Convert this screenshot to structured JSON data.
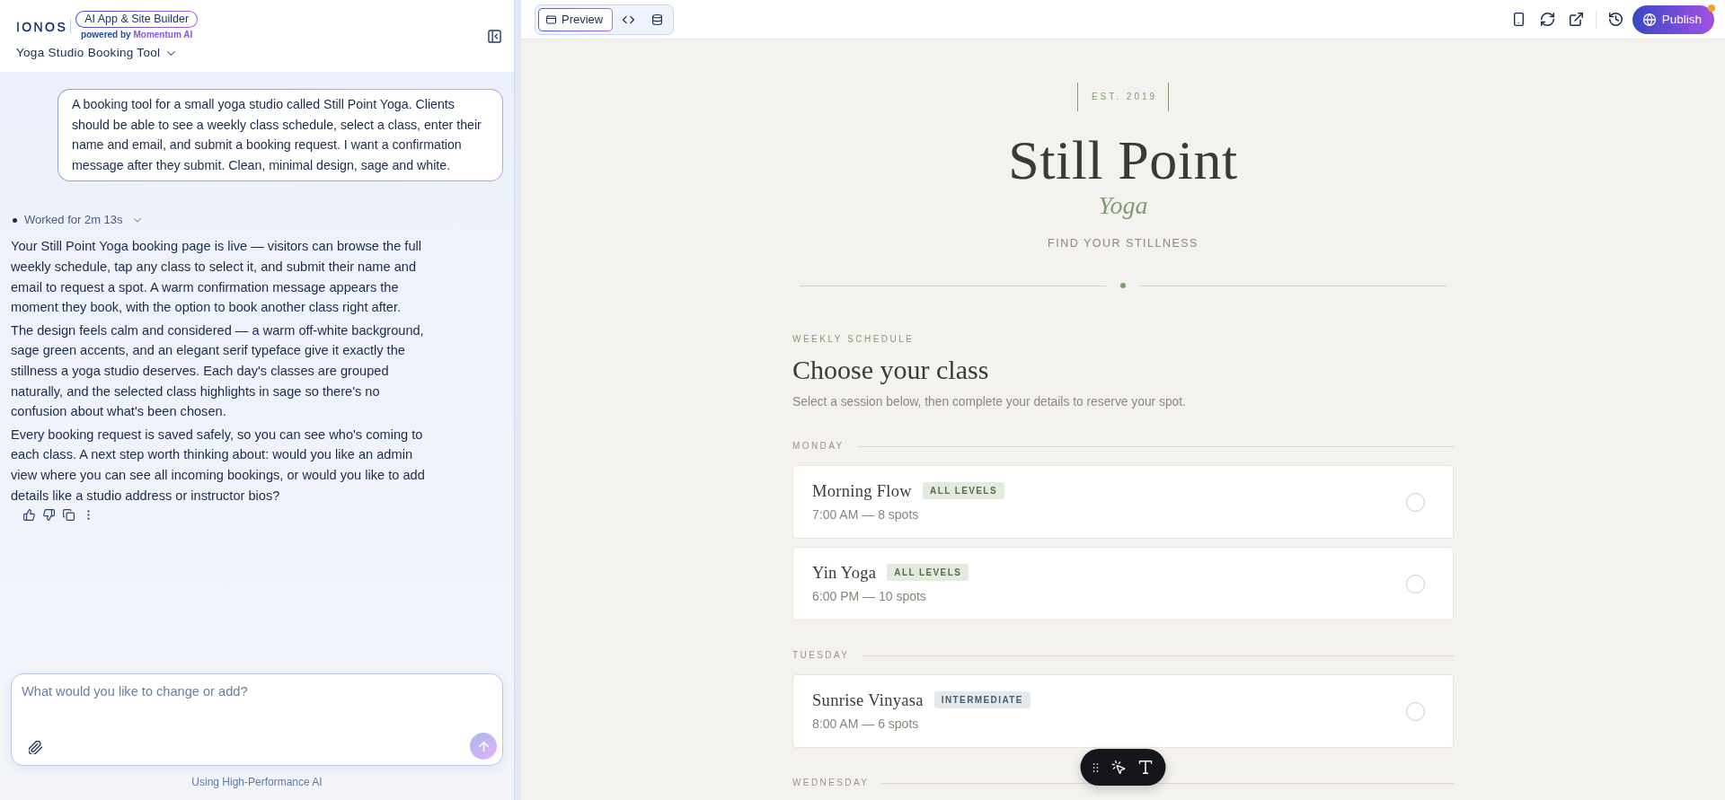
{
  "header": {
    "logo": "IONOS",
    "product_badge": "AI App & Site Builder",
    "powered_by": "powered by",
    "powered_by_brand": "Momentum AI",
    "project_title": "Yoga Studio Booking Tool"
  },
  "chat": {
    "prompt": "A booking tool for a small yoga studio called Still Point Yoga. Clients should be able to see a weekly class schedule, select a class, enter their name and email, and submit a booking request. I want a confirmation message after they submit. Clean, minimal design, sage and white.",
    "status": {
      "text": "Worked for 2m 13s",
      "expanded": false
    },
    "reply": [
      "Your Still Point Yoga booking page is live — visitors can browse the full weekly schedule, tap any class to select it, and submit their name and email to request a spot. A warm confirmation message appears the moment they book, with the option to book another class right after.",
      "The design feels calm and considered — a warm off-white background, sage green accents, and an elegant serif typeface give it exactly the stillness a yoga studio deserves. Each day's classes are grouped naturally, and the selected class highlights in sage so there's no confusion about what's been chosen.",
      "Every booking request is saved safely, so you can see who's coming to each class. A next step worth thinking about: would you like an admin view where you can see all incoming bookings, or would you like to add details like a studio address or instructor bios?"
    ]
  },
  "composer": {
    "placeholder": "What would you like to change or add?",
    "send_disabled": true,
    "footnote": "Using High-Performance AI"
  },
  "topbar": {
    "view_tabs": [
      {
        "kind": "preview",
        "label": "Preview",
        "selected": true
      },
      {
        "kind": "code",
        "selected": false
      },
      {
        "kind": "database",
        "selected": false
      }
    ],
    "publish": {
      "label": "Publish",
      "notification": true
    }
  },
  "site": {
    "est": "EST. 2019",
    "title": "Still Point",
    "subtitle": "Yoga",
    "tagline": "FIND YOUR STILLNESS",
    "schedule": {
      "eyebrow": "WEEKLY SCHEDULE",
      "heading": "Choose your class",
      "intro": "Select a session below, then complete your details to reserve your spot.",
      "days": [
        {
          "name": "MONDAY",
          "classes": [
            {
              "name": "Morning Flow",
              "badge": {
                "label": "ALL LEVELS",
                "color": "#e2ebdd"
              },
              "details": "7:00 AM — 8 spots",
              "selected": false
            },
            {
              "name": "Yin Yoga",
              "badge": {
                "label": "ALL LEVELS",
                "color": "#e2ebdd"
              },
              "details": "6:00 PM — 10 spots",
              "selected": false
            }
          ]
        },
        {
          "name": "TUESDAY",
          "classes": [
            {
              "name": "Sunrise Vinyasa",
              "badge": {
                "label": "INTERMEDIATE",
                "color": "#e4e9ed"
              },
              "details": "8:00 AM — 6 spots",
              "selected": false
            }
          ]
        },
        {
          "name": "WEDNESDAY"
        }
      ]
    }
  }
}
